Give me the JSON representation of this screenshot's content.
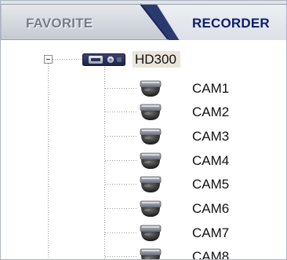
{
  "tabs": {
    "favorite": {
      "label": "FAVORITE",
      "active": false
    },
    "recorder": {
      "label": "RECORDER",
      "active": true
    }
  },
  "tree": {
    "recorder": {
      "label": "HD300",
      "icon": "dvr-recorder-icon",
      "expanded": true,
      "selected": true
    },
    "cameras": [
      {
        "label": "CAM1",
        "icon": "dome-camera-icon"
      },
      {
        "label": "CAM2",
        "icon": "dome-camera-icon"
      },
      {
        "label": "CAM3",
        "icon": "dome-camera-icon"
      },
      {
        "label": "CAM4",
        "icon": "dome-camera-icon"
      },
      {
        "label": "CAM5",
        "icon": "dome-camera-icon"
      },
      {
        "label": "CAM6",
        "icon": "dome-camera-icon"
      },
      {
        "label": "CAM7",
        "icon": "dome-camera-icon"
      },
      {
        "label": "CAM8",
        "icon": "dome-camera-icon"
      }
    ]
  },
  "colors": {
    "active_tab_text": "#0f1c6e",
    "inactive_tab_text": "#747e88",
    "selection_highlight": "#e9e5da"
  }
}
